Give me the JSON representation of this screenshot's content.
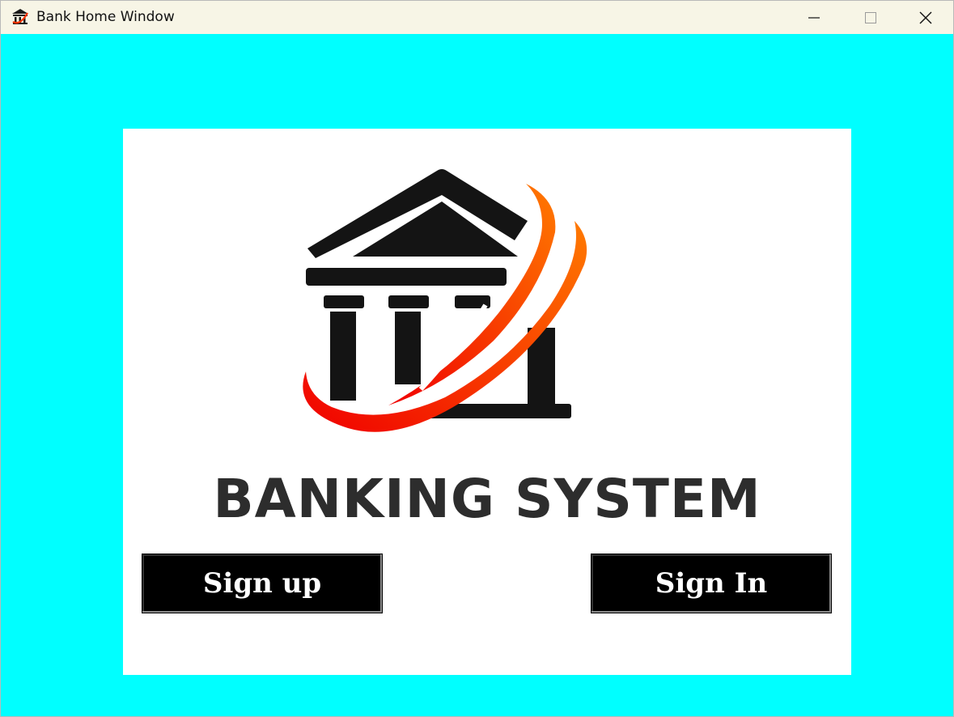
{
  "window": {
    "title": "Bank Home Window",
    "icon": "bank-icon",
    "controls": [
      "minimize-icon",
      "maximize-icon",
      "close-icon"
    ]
  },
  "colors": {
    "window_background": "#00ffff",
    "panel_background": "#ffffff",
    "titlebar_background": "#f7f5e6",
    "logo_building": "#141414",
    "logo_swoosh_start": "#f00000",
    "logo_swoosh_end": "#ff7a00",
    "button_background": "#000000",
    "button_text": "#ffffff",
    "heading_text": "#2d2d2d"
  },
  "main": {
    "logo": "bank-building-logo",
    "heading": "BANKING SYSTEM",
    "buttons": {
      "signup_label": "Sign up",
      "signin_label": "Sign In"
    }
  }
}
